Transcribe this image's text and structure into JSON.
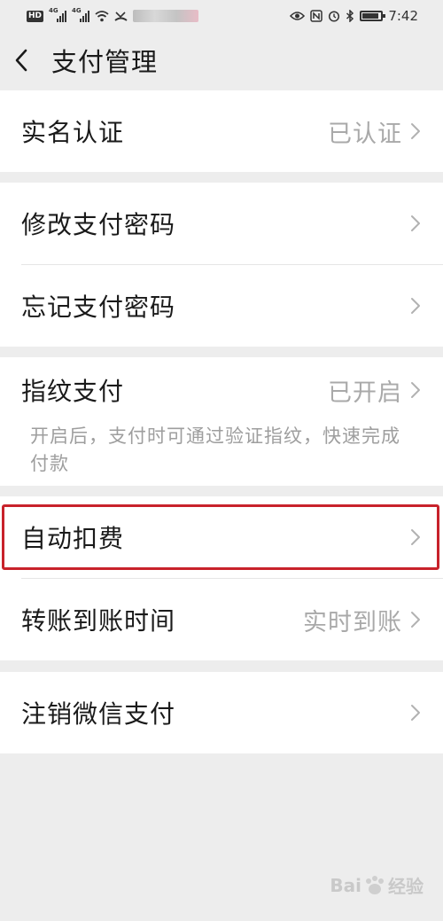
{
  "status_bar": {
    "hd": "HD",
    "net1": "4G",
    "net2": "4G",
    "time": "7:42"
  },
  "header": {
    "title": "支付管理"
  },
  "groups": [
    {
      "rows": [
        {
          "label": "实名认证",
          "value": "已认证"
        }
      ]
    },
    {
      "rows": [
        {
          "label": "修改支付密码",
          "value": ""
        },
        {
          "label": "忘记支付密码",
          "value": ""
        }
      ]
    },
    {
      "rows": [
        {
          "label": "指纹支付",
          "value": "已开启",
          "description": "开启后，支付时可通过验证指纹，快速完成付款"
        }
      ]
    },
    {
      "rows": [
        {
          "label": "自动扣费",
          "value": ""
        },
        {
          "label": "转账到账时间",
          "value": "实时到账"
        }
      ]
    },
    {
      "rows": [
        {
          "label": "注销微信支付",
          "value": ""
        }
      ]
    }
  ],
  "icons": {
    "back": "chevron-left-icon",
    "row_arrow": "chevron-right-icon"
  },
  "colors": {
    "background": "#ededed",
    "highlight": "#c8222b",
    "secondary_text": "#a9a9a9"
  },
  "watermark": {
    "brand_left": "Bai",
    "brand_right": "经验"
  }
}
